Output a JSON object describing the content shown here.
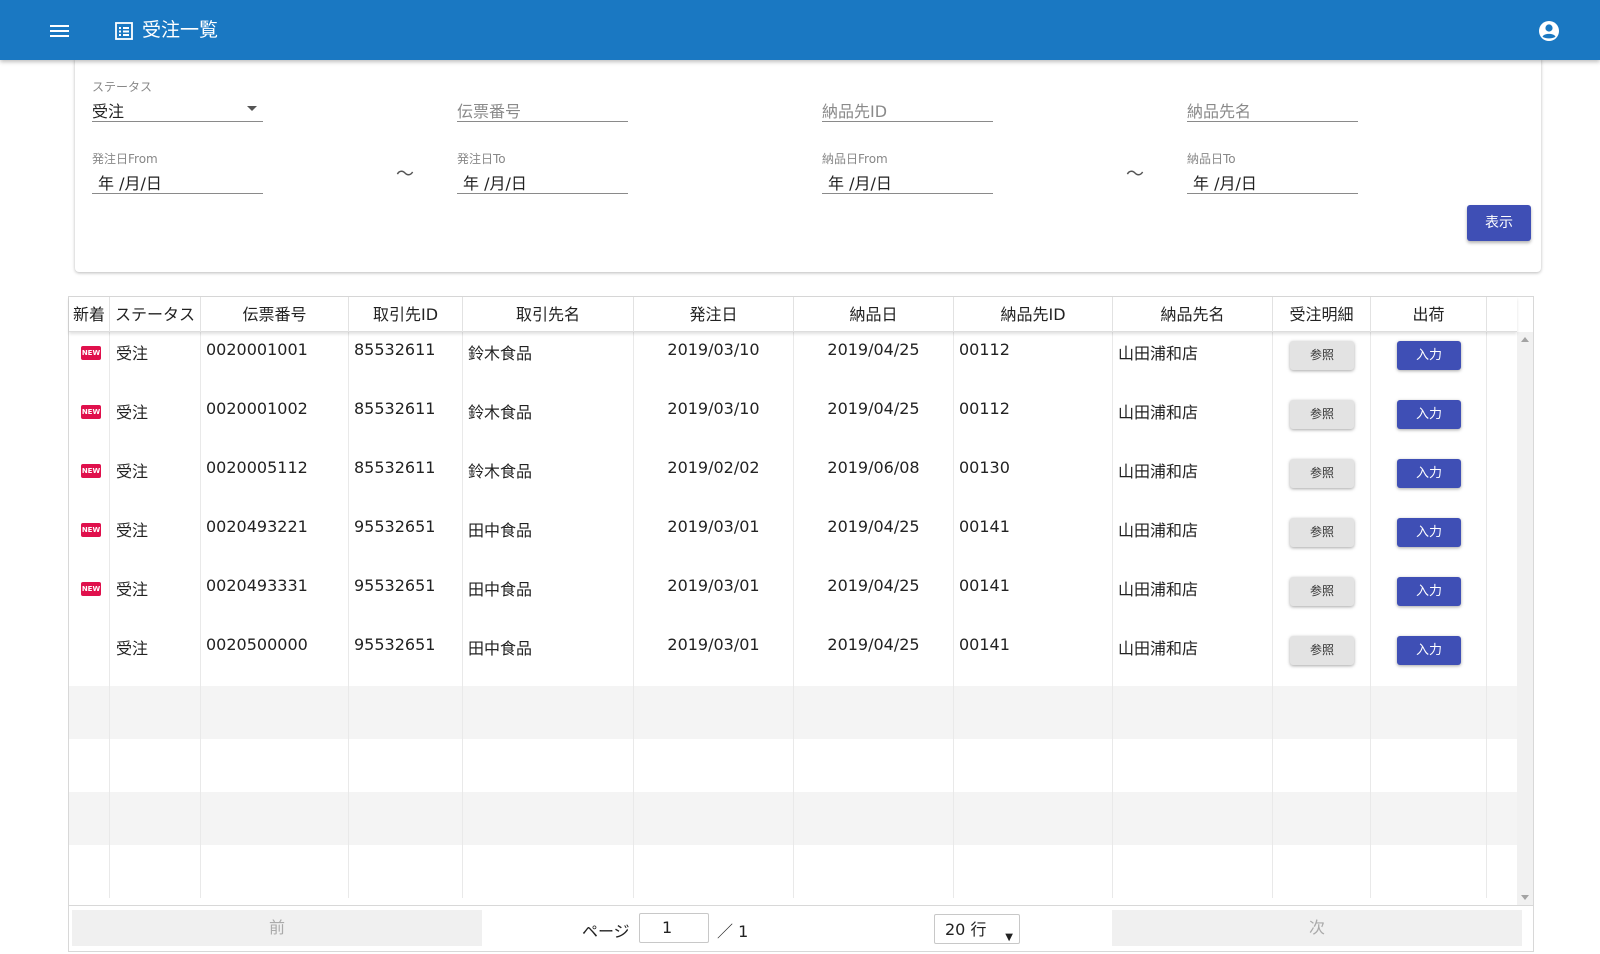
{
  "appbar": {
    "title": "受注一覧",
    "colors": {
      "bar": "#1a78c2",
      "text": "#ffffff"
    },
    "icons": {
      "menu": "menu-icon",
      "title": "list-alt-icon",
      "account": "account-circle-icon"
    }
  },
  "filters": {
    "status": {
      "label": "ステータス",
      "value": "受注"
    },
    "slip_no": {
      "placeholder": "伝票番号"
    },
    "delivery_id": {
      "placeholder": "納品先ID"
    },
    "delivery_name": {
      "placeholder": "納品先名"
    },
    "order_date_from": {
      "label": "発注日From",
      "value": "年 /月/日"
    },
    "order_date_to": {
      "label": "発注日To",
      "value": "年 /月/日"
    },
    "delivery_date_from": {
      "label": "納品日From",
      "value": "年 /月/日"
    },
    "delivery_date_to": {
      "label": "納品日To",
      "value": "年 /月/日"
    },
    "range_separator": "～",
    "show_button": "表示"
  },
  "table": {
    "headers": [
      "新着",
      "ステータス",
      "伝票番号",
      "取引先ID",
      "取引先名",
      "発注日",
      "納品日",
      "納品先ID",
      "納品先名",
      "受注明細",
      "出荷"
    ],
    "ref_label": "参照",
    "input_label": "入力",
    "new_badge": "NEW",
    "rows": [
      {
        "new": "NEW",
        "status": "受注",
        "slip_no": "0020001001",
        "client_id": "85532611",
        "client_name": "鈴木食品",
        "order_date": "2019/03/10",
        "delivery_date": "2019/04/25",
        "delivery_id": "00112",
        "delivery_name": "山田浦和店"
      },
      {
        "new": "NEW",
        "status": "受注",
        "slip_no": "0020001002",
        "client_id": "85532611",
        "client_name": "鈴木食品",
        "order_date": "2019/03/10",
        "delivery_date": "2019/04/25",
        "delivery_id": "00112",
        "delivery_name": "山田浦和店"
      },
      {
        "new": "NEW",
        "status": "受注",
        "slip_no": "0020005112",
        "client_id": "85532611",
        "client_name": "鈴木食品",
        "order_date": "2019/02/02",
        "delivery_date": "2019/06/08",
        "delivery_id": "00130",
        "delivery_name": "山田浦和店"
      },
      {
        "new": "NEW",
        "status": "受注",
        "slip_no": "0020493221",
        "client_id": "95532651",
        "client_name": "田中食品",
        "order_date": "2019/03/01",
        "delivery_date": "2019/04/25",
        "delivery_id": "00141",
        "delivery_name": "山田浦和店"
      },
      {
        "new": "NEW",
        "status": "受注",
        "slip_no": "0020493331",
        "client_id": "95532651",
        "client_name": "田中食品",
        "order_date": "2019/03/01",
        "delivery_date": "2019/04/25",
        "delivery_id": "00141",
        "delivery_name": "山田浦和店"
      },
      {
        "new": "",
        "status": "受注",
        "slip_no": "0020500000",
        "client_id": "95532651",
        "client_name": "田中食品",
        "order_date": "2019/03/01",
        "delivery_date": "2019/04/25",
        "delivery_id": "00141",
        "delivery_name": "山田浦和店"
      }
    ]
  },
  "pager": {
    "prev": "前",
    "next": "次",
    "page_label": "ページ",
    "current_page": "1",
    "total": "／ 1",
    "rows_per_page": "20 行"
  }
}
